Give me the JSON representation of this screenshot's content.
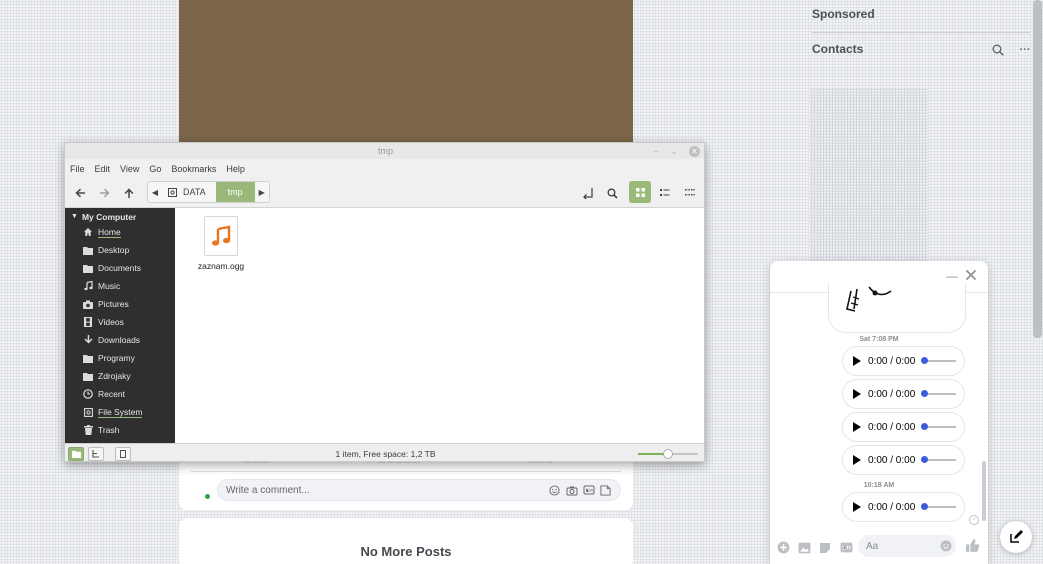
{
  "colors": {
    "accent_green": "#9ab87a",
    "messenger_blue": "#3b5ddd",
    "sidebar_bg": "#2f2f2f"
  },
  "feed": {
    "comment_placeholder": "Write a comment...",
    "no_more_posts": "No More Posts"
  },
  "right_column": {
    "sponsored": "Sponsored",
    "contacts": "Contacts"
  },
  "messenger": {
    "timestamp_1": "Sat 7:08 PM",
    "timestamp_2": "10:18 AM",
    "audio_messages": [
      {
        "time": "0:00 / 0:00",
        "progress": 0
      },
      {
        "time": "0:00 / 0:00",
        "progress": 0
      },
      {
        "time": "0:00 / 0:00",
        "progress": 0
      },
      {
        "time": "0:00 / 0:00",
        "progress": 0
      },
      {
        "time": "0:00 / 0:00",
        "progress": 0
      }
    ],
    "input_placeholder": "Aa"
  },
  "file_manager": {
    "window_title": "tmp",
    "menu": [
      "File",
      "Edit",
      "View",
      "Go",
      "Bookmarks",
      "Help"
    ],
    "breadcrumbs": [
      "DATA",
      "tmp"
    ],
    "sidebar_header": "My Computer",
    "sidebar_items": [
      "Home",
      "Desktop",
      "Documents",
      "Music",
      "Pictures",
      "Videos",
      "Downloads",
      "Programy",
      "Zdrojaky",
      "Recent",
      "File System",
      "Trash"
    ],
    "files": [
      {
        "name": "zaznam.ogg",
        "icon": "music-note-icon"
      }
    ],
    "status_text": "1 item, Free space: 1,2 TB",
    "zoom_level": 0.5
  }
}
